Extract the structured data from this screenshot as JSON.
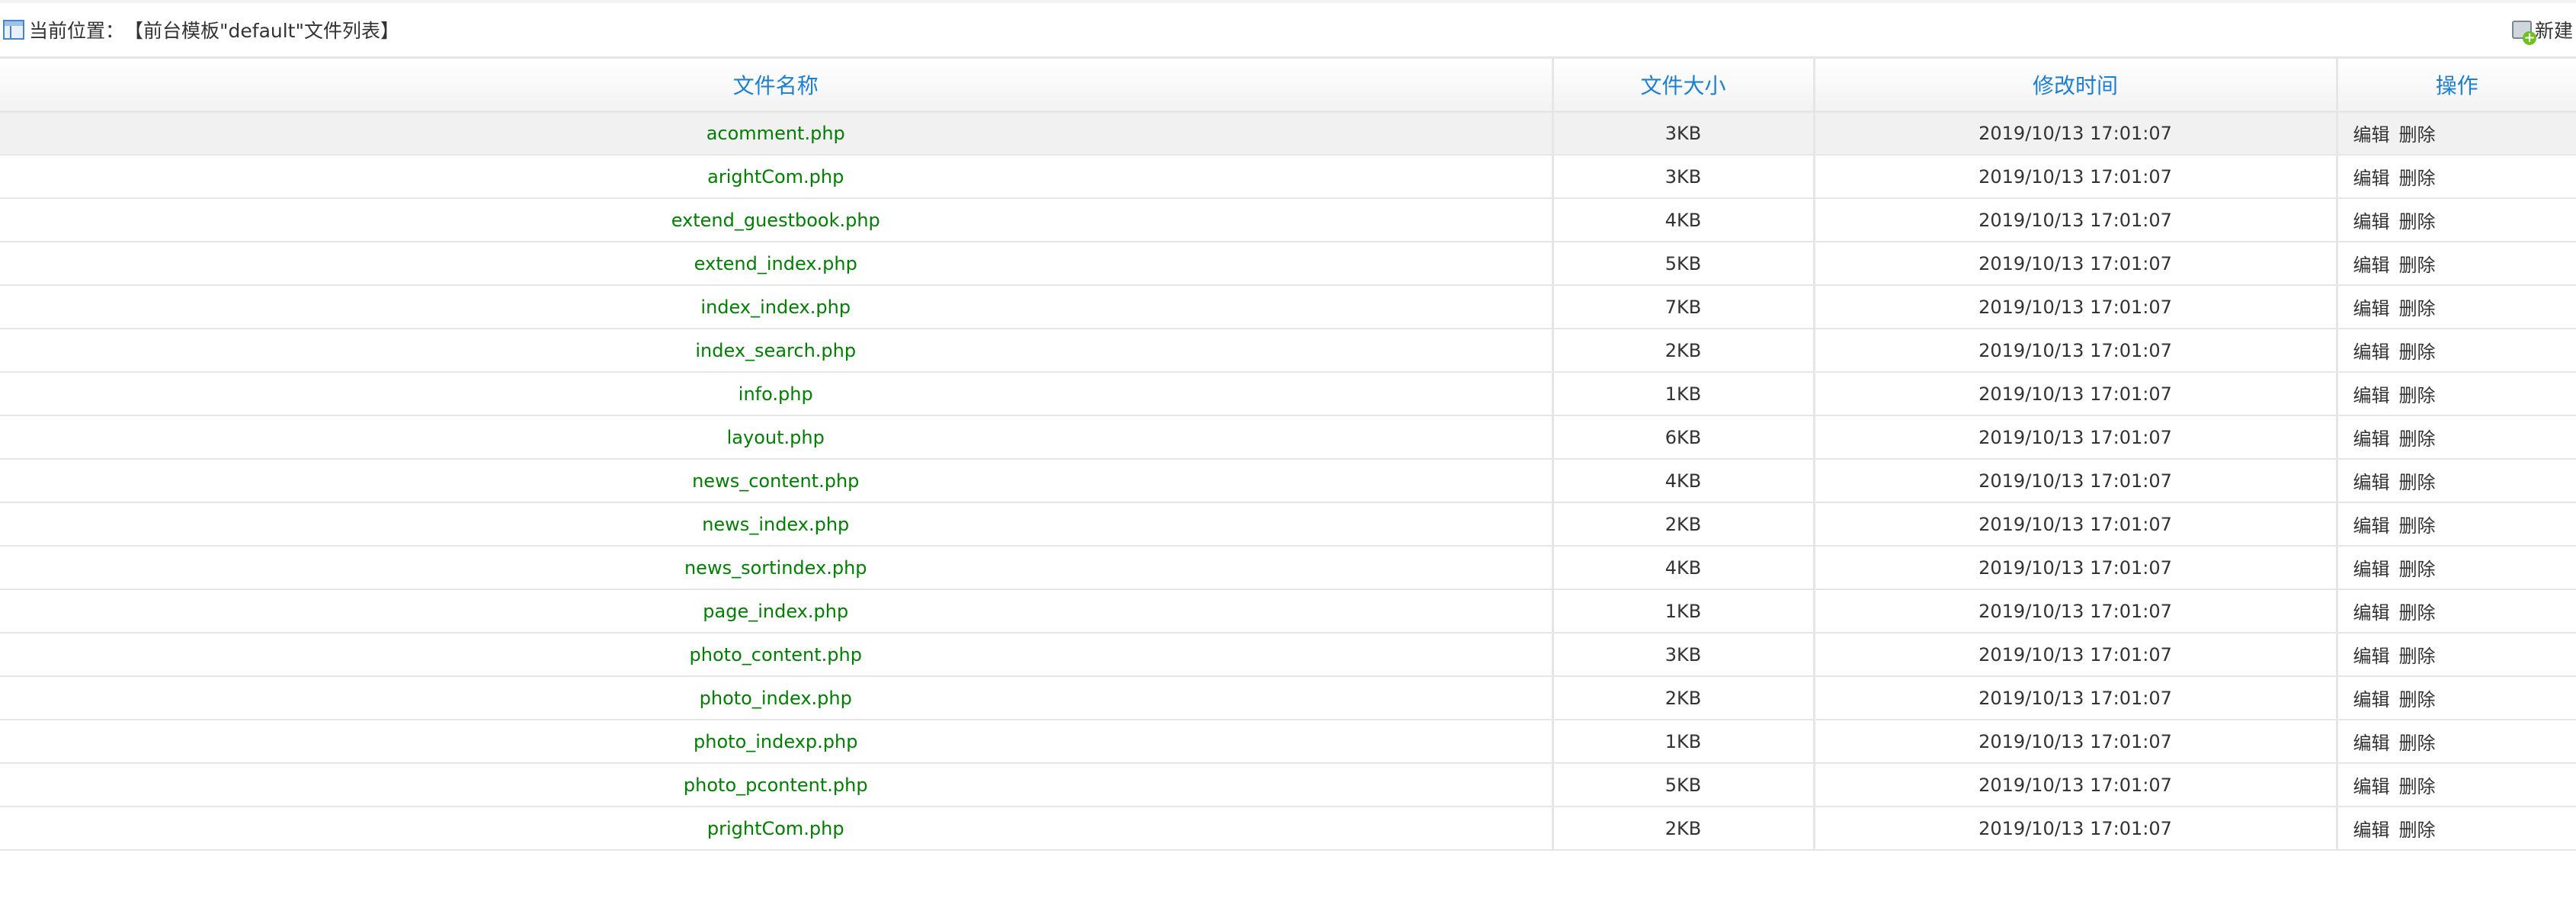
{
  "breadcrumb": {
    "label": "当前位置：",
    "path": "【前台模板\"default\"文件列表】"
  },
  "new_button": "新建",
  "columns": [
    "文件名称",
    "文件大小",
    "修改时间",
    "操作"
  ],
  "actions": {
    "edit": "编辑",
    "delete": "删除"
  },
  "rows": [
    {
      "name": "acomment.php",
      "size": "3KB",
      "time": "2019/10/13 17:01:07"
    },
    {
      "name": "arightCom.php",
      "size": "3KB",
      "time": "2019/10/13 17:01:07"
    },
    {
      "name": "extend_guestbook.php",
      "size": "4KB",
      "time": "2019/10/13 17:01:07"
    },
    {
      "name": "extend_index.php",
      "size": "5KB",
      "time": "2019/10/13 17:01:07"
    },
    {
      "name": "index_index.php",
      "size": "7KB",
      "time": "2019/10/13 17:01:07"
    },
    {
      "name": "index_search.php",
      "size": "2KB",
      "time": "2019/10/13 17:01:07"
    },
    {
      "name": "info.php",
      "size": "1KB",
      "time": "2019/10/13 17:01:07"
    },
    {
      "name": "layout.php",
      "size": "6KB",
      "time": "2019/10/13 17:01:07"
    },
    {
      "name": "news_content.php",
      "size": "4KB",
      "time": "2019/10/13 17:01:07"
    },
    {
      "name": "news_index.php",
      "size": "2KB",
      "time": "2019/10/13 17:01:07"
    },
    {
      "name": "news_sortindex.php",
      "size": "4KB",
      "time": "2019/10/13 17:01:07"
    },
    {
      "name": "page_index.php",
      "size": "1KB",
      "time": "2019/10/13 17:01:07"
    },
    {
      "name": "photo_content.php",
      "size": "3KB",
      "time": "2019/10/13 17:01:07"
    },
    {
      "name": "photo_index.php",
      "size": "2KB",
      "time": "2019/10/13 17:01:07"
    },
    {
      "name": "photo_indexp.php",
      "size": "1KB",
      "time": "2019/10/13 17:01:07"
    },
    {
      "name": "photo_pcontent.php",
      "size": "5KB",
      "time": "2019/10/13 17:01:07"
    },
    {
      "name": "prightCom.php",
      "size": "2KB",
      "time": "2019/10/13 17:01:07"
    }
  ]
}
